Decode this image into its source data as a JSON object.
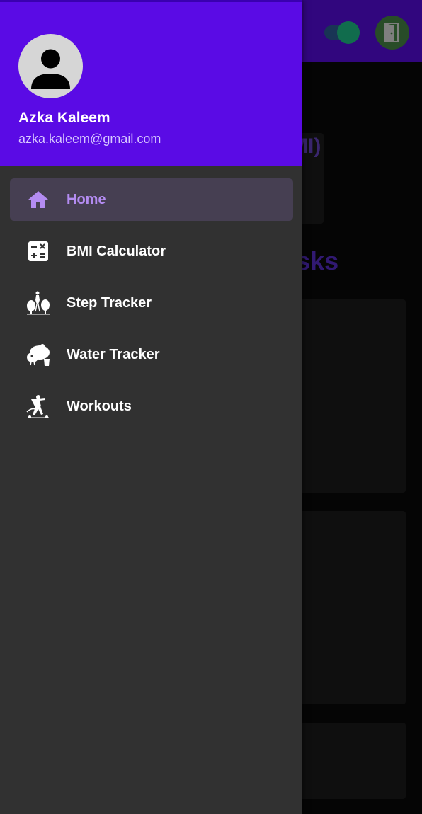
{
  "background": {
    "partial_heading_1": "MI)",
    "partial_heading_2": "asks"
  },
  "drawer": {
    "user": {
      "name": "Azka Kaleem",
      "email": "azka.kaleem@gmail.com"
    },
    "items": [
      {
        "label": "Home",
        "icon": "home-icon",
        "active": true
      },
      {
        "label": "BMI Calculator",
        "icon": "calculator-icon",
        "active": false
      },
      {
        "label": "Step Tracker",
        "icon": "footsteps-icon",
        "active": false
      },
      {
        "label": "Water Tracker",
        "icon": "water-icon",
        "active": false
      },
      {
        "label": "Workouts",
        "icon": "workout-icon",
        "active": false
      }
    ]
  },
  "colors": {
    "primary": "#5a0be5",
    "active_accent": "#b48cf2",
    "drawer_bg": "#313131",
    "toggle_on": "#1fc58c"
  }
}
